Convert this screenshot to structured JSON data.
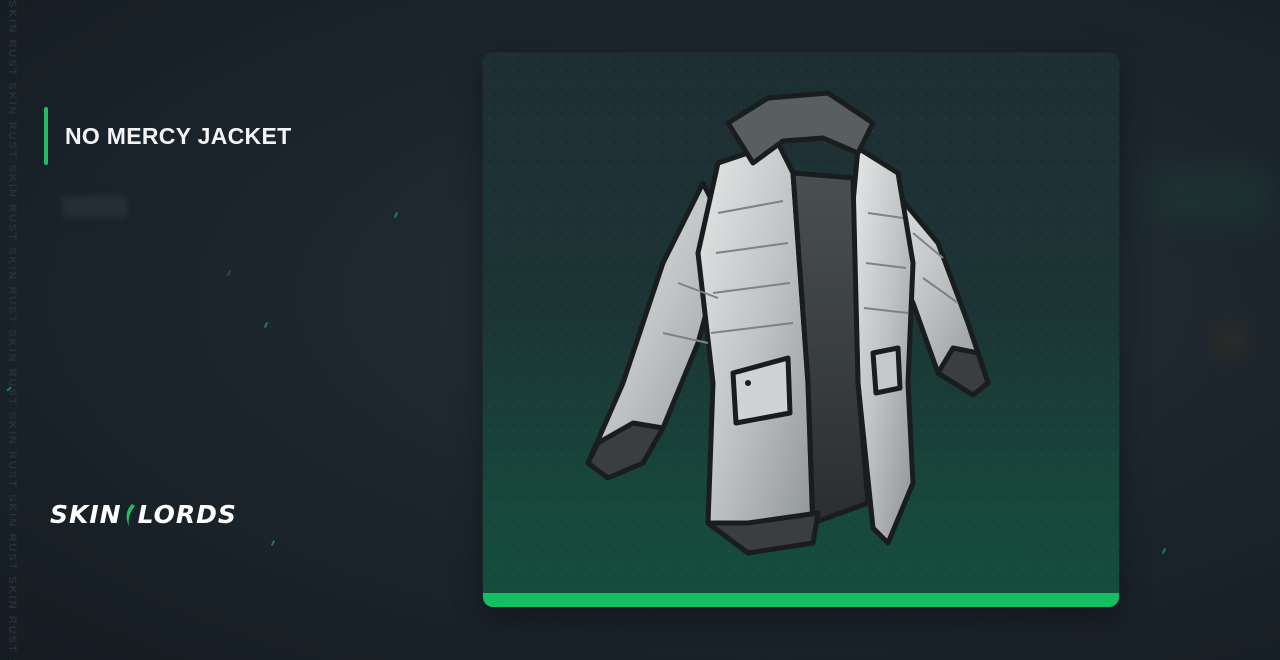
{
  "item": {
    "title": "NO MERCY JACKET",
    "image_alt": "No Mercy Jacket skin"
  },
  "brand": {
    "logo_left": "SKIN",
    "logo_right": "LORDS",
    "accent_color": "#1fbf5f"
  },
  "watermark": {
    "text": "SKIN RUST SKIN RUST SKIN RUST SKIN RUST SKIN RUST SKIN RUST SKIN RUST SKIN RUST SKIN"
  },
  "card": {
    "bar_color": "#12c061"
  }
}
